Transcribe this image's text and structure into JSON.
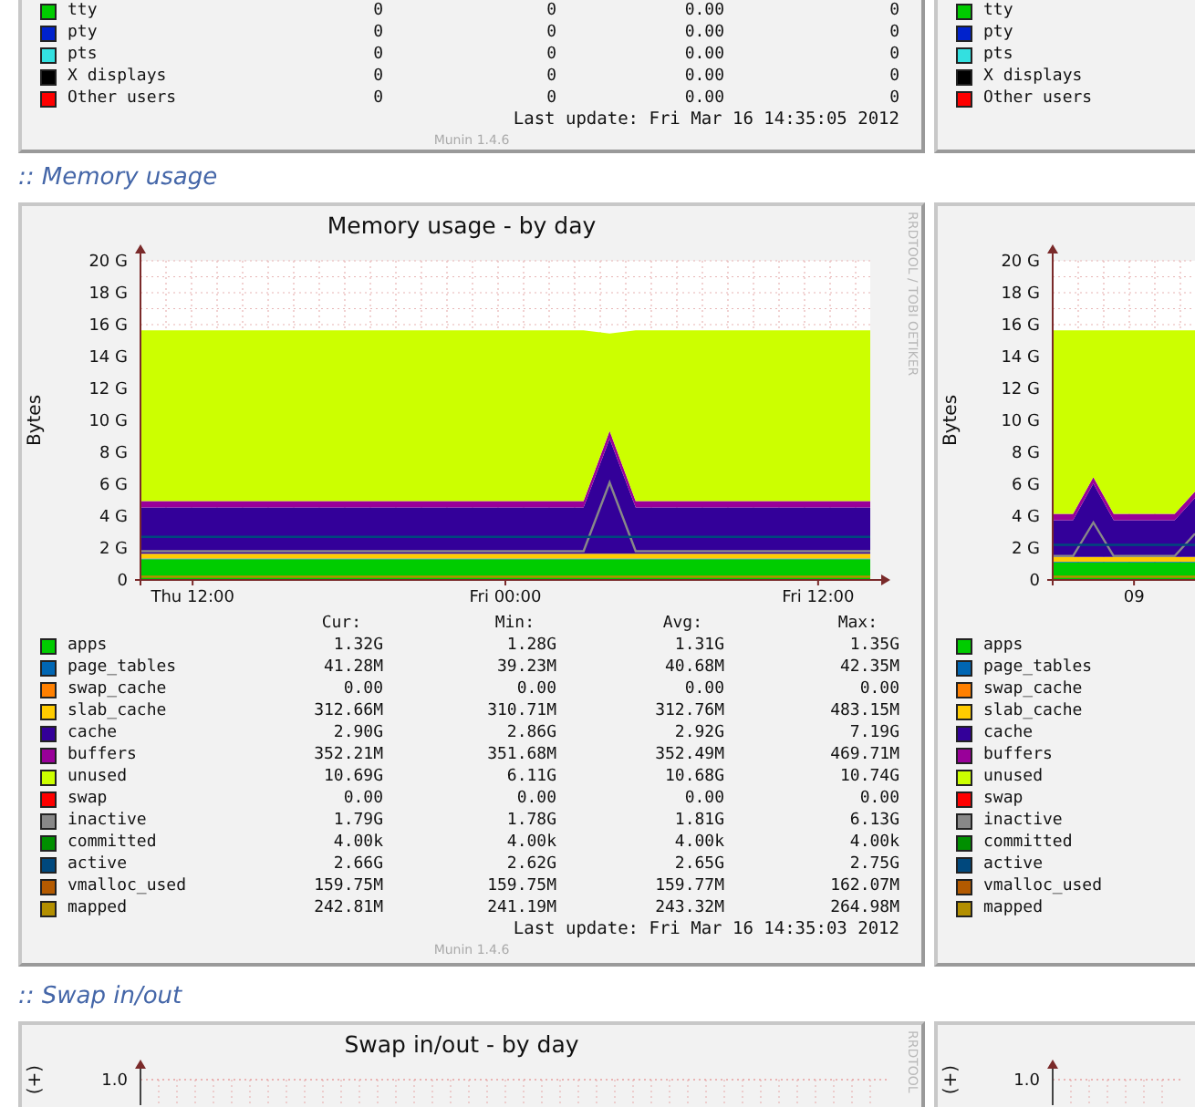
{
  "sections": [
    {
      "panels": [
        {
          "legend": [
            {
              "name": "tty",
              "color": "#00cc00",
              "cur": "0",
              "min": "0",
              "avg": "0.00",
              "max": "0"
            },
            {
              "name": "pty",
              "color": "#0022cc",
              "cur": "0",
              "min": "0",
              "avg": "0.00",
              "max": "0"
            },
            {
              "name": "pts",
              "color": "#33e0e0",
              "cur": "0",
              "min": "0",
              "avg": "0.00",
              "max": "0"
            },
            {
              "name": "X displays",
              "color": "#000000",
              "cur": "0",
              "min": "0",
              "avg": "0.00",
              "max": "0"
            },
            {
              "name": "Other users",
              "color": "#ff0000",
              "cur": "0",
              "min": "0",
              "avg": "0.00",
              "max": "0"
            }
          ],
          "last_update": "Last update: Fri Mar 16 14:35:05 2012",
          "version": "Munin 1.4.6"
        },
        {
          "legend": [
            {
              "name": "tty",
              "color": "#00cc00"
            },
            {
              "name": "pty",
              "color": "#0022cc"
            },
            {
              "name": "pts",
              "color": "#33e0e0"
            },
            {
              "name": "X displays",
              "color": "#000000"
            },
            {
              "name": "Other users",
              "color": "#ff0000"
            }
          ]
        }
      ]
    },
    {
      "heading": ":: Memory usage",
      "panels": [
        {
          "vendor_text": "RRDTOOL / TOBI OETIKER",
          "chart_data": {
            "type": "area",
            "stacked": true,
            "grid": true,
            "title": "Memory usage - by day",
            "ylabel": "Bytes",
            "ylim": [
              0,
              20
            ],
            "categories": [
              null,
              null,
              "Thu 12:00",
              null,
              null,
              null,
              null,
              null,
              null,
              null,
              null,
              null,
              null,
              null,
              "Fri 00:00",
              null,
              null,
              null,
              null,
              null,
              null,
              null,
              null,
              null,
              null,
              null,
              "Fri 12:00",
              null,
              null
            ],
            "yticks": [
              {
                "value": 0,
                "label": "0"
              },
              {
                "value": 2,
                "label": "2 G"
              },
              {
                "value": 4,
                "label": "4 G"
              },
              {
                "value": 6,
                "label": "6 G"
              },
              {
                "value": 8,
                "label": "8 G"
              },
              {
                "value": 10,
                "label": "10 G"
              },
              {
                "value": 12,
                "label": "12 G"
              },
              {
                "value": 14,
                "label": "14 G"
              },
              {
                "value": 16,
                "label": "16 G"
              },
              {
                "value": 18,
                "label": "18 G"
              },
              {
                "value": 20,
                "label": "20 G"
              }
            ],
            "series": [
              {
                "name": "apps",
                "type": "area",
                "color": "#00cc00",
                "values": [
                  1.3,
                  1.3,
                  1.3,
                  1.3,
                  1.3,
                  1.3,
                  1.3,
                  1.3,
                  1.3,
                  1.3,
                  1.3,
                  1.3,
                  1.3,
                  1.3,
                  1.3,
                  1.3,
                  1.3,
                  1.3,
                  1.3,
                  1.3,
                  1.3,
                  1.3,
                  1.3,
                  1.3,
                  1.3,
                  1.3,
                  1.3,
                  1.3,
                  1.3
                ]
              },
              {
                "name": "page_tables",
                "type": "area",
                "color": "#0066b3",
                "values": [
                  0.04,
                  0.04,
                  0.04,
                  0.04,
                  0.04,
                  0.04,
                  0.04,
                  0.04,
                  0.04,
                  0.04,
                  0.04,
                  0.04,
                  0.04,
                  0.04,
                  0.04,
                  0.04,
                  0.04,
                  0.04,
                  0.04,
                  0.04,
                  0.04,
                  0.04,
                  0.04,
                  0.04,
                  0.04,
                  0.04,
                  0.04,
                  0.04,
                  0.04
                ]
              },
              {
                "name": "swap_cache",
                "type": "area",
                "color": "#ff8000",
                "values": [
                  null,
                  null,
                  null,
                  null,
                  null,
                  null,
                  null,
                  null,
                  null,
                  null,
                  null,
                  null,
                  null,
                  null,
                  null,
                  null,
                  null,
                  null,
                  null,
                  null,
                  null,
                  null,
                  null,
                  null,
                  null,
                  null,
                  null,
                  null,
                  null
                ]
              },
              {
                "name": "slab_cache",
                "type": "area",
                "color": "#ffcc00",
                "values": [
                  0.3,
                  0.3,
                  0.3,
                  0.3,
                  0.3,
                  0.3,
                  0.3,
                  0.3,
                  0.3,
                  0.3,
                  0.3,
                  0.3,
                  0.3,
                  0.3,
                  0.3,
                  0.3,
                  0.3,
                  0.3,
                  0.3,
                  0.3,
                  0.3,
                  0.3,
                  0.3,
                  0.3,
                  0.3,
                  0.3,
                  0.3,
                  0.3,
                  0.3
                ]
              },
              {
                "name": "cache",
                "type": "area",
                "color": "#330099",
                "values": [
                  2.9,
                  2.9,
                  2.9,
                  2.9,
                  2.9,
                  2.9,
                  2.9,
                  2.9,
                  2.9,
                  2.9,
                  2.9,
                  2.9,
                  2.9,
                  2.9,
                  2.9,
                  2.9,
                  2.9,
                  2.9,
                  7.2,
                  2.9,
                  2.9,
                  2.9,
                  2.9,
                  2.9,
                  2.9,
                  2.9,
                  2.9,
                  2.9,
                  2.9
                ]
              },
              {
                "name": "buffers",
                "type": "area",
                "color": "#990099",
                "values": [
                  0.4,
                  0.4,
                  0.4,
                  0.4,
                  0.4,
                  0.4,
                  0.4,
                  0.4,
                  0.4,
                  0.4,
                  0.4,
                  0.4,
                  0.4,
                  0.4,
                  0.4,
                  0.4,
                  0.4,
                  0.4,
                  0.5,
                  0.4,
                  0.4,
                  0.4,
                  0.4,
                  0.4,
                  0.4,
                  0.4,
                  0.4,
                  0.4,
                  0.4
                ]
              },
              {
                "name": "unused",
                "type": "area",
                "color": "#ccff00",
                "values": [
                  10.7,
                  10.7,
                  10.7,
                  10.7,
                  10.7,
                  10.7,
                  10.7,
                  10.7,
                  10.7,
                  10.7,
                  10.7,
                  10.7,
                  10.7,
                  10.7,
                  10.7,
                  10.7,
                  10.7,
                  10.7,
                  6.1,
                  10.7,
                  10.7,
                  10.7,
                  10.7,
                  10.7,
                  10.7,
                  10.7,
                  10.7,
                  10.7,
                  10.7
                ]
              },
              {
                "name": "swap",
                "type": "area",
                "color": "#ff0000",
                "values": [
                  null,
                  null,
                  null,
                  null,
                  null,
                  null,
                  null,
                  null,
                  null,
                  null,
                  null,
                  null,
                  null,
                  null,
                  null,
                  null,
                  null,
                  null,
                  null,
                  null,
                  null,
                  null,
                  null,
                  null,
                  null,
                  null,
                  null,
                  null,
                  null
                ]
              },
              {
                "name": "inactive",
                "type": "line",
                "color": "#888888",
                "values": [
                  1.8,
                  1.8,
                  1.8,
                  1.8,
                  1.8,
                  1.8,
                  1.8,
                  1.8,
                  1.8,
                  1.8,
                  1.8,
                  1.8,
                  1.8,
                  1.8,
                  1.8,
                  1.8,
                  1.8,
                  1.8,
                  6.1,
                  1.8,
                  1.8,
                  1.8,
                  1.8,
                  1.8,
                  1.8,
                  1.8,
                  1.8,
                  1.8,
                  1.8
                ]
              },
              {
                "name": "committed",
                "type": "line",
                "color": "#008f00",
                "values": [
                  null,
                  null,
                  null,
                  null,
                  null,
                  null,
                  null,
                  null,
                  null,
                  null,
                  null,
                  null,
                  null,
                  null,
                  null,
                  null,
                  null,
                  null,
                  null,
                  null,
                  null,
                  null,
                  null,
                  null,
                  null,
                  null,
                  null,
                  null,
                  null
                ]
              },
              {
                "name": "active",
                "type": "line",
                "color": "#00487d",
                "values": [
                  2.7,
                  2.7,
                  2.7,
                  2.7,
                  2.7,
                  2.7,
                  2.7,
                  2.7,
                  2.7,
                  2.7,
                  2.7,
                  2.7,
                  2.7,
                  2.7,
                  2.7,
                  2.7,
                  2.7,
                  2.7,
                  2.7,
                  2.7,
                  2.7,
                  2.7,
                  2.7,
                  2.7,
                  2.7,
                  2.7,
                  2.7,
                  2.7,
                  2.7
                ]
              },
              {
                "name": "vmalloc_used",
                "type": "line",
                "color": "#b35a00",
                "values": [
                  null,
                  null,
                  null,
                  null,
                  null,
                  null,
                  null,
                  null,
                  null,
                  null,
                  null,
                  null,
                  null,
                  null,
                  null,
                  null,
                  null,
                  null,
                  null,
                  null,
                  null,
                  null,
                  null,
                  null,
                  null,
                  null,
                  null,
                  null,
                  null
                ]
              },
              {
                "name": "mapped",
                "type": "line",
                "color": "#b38f00",
                "values": [
                  0.2,
                  0.2,
                  0.2,
                  0.2,
                  0.2,
                  0.2,
                  0.2,
                  0.2,
                  0.2,
                  0.2,
                  0.2,
                  0.2,
                  0.2,
                  0.2,
                  0.2,
                  0.2,
                  0.2,
                  0.2,
                  0.2,
                  0.2,
                  0.2,
                  0.2,
                  0.2,
                  0.2,
                  0.2,
                  0.2,
                  0.2,
                  0.2,
                  0.2
                ]
              }
            ]
          },
          "legend_headers": [
            "Cur:",
            "Min:",
            "Avg:",
            "Max:"
          ],
          "stats": [
            {
              "cur": "1.32G",
              "min": "1.28G",
              "avg": "1.31G",
              "max": "1.35G"
            },
            {
              "cur": "41.28M",
              "min": "39.23M",
              "avg": "40.68M",
              "max": "42.35M"
            },
            {
              "cur": "0.00",
              "min": "0.00",
              "avg": "0.00",
              "max": "0.00"
            },
            {
              "cur": "312.66M",
              "min": "310.71M",
              "avg": "312.76M",
              "max": "483.15M"
            },
            {
              "cur": "2.90G",
              "min": "2.86G",
              "avg": "2.92G",
              "max": "7.19G"
            },
            {
              "cur": "352.21M",
              "min": "351.68M",
              "avg": "352.49M",
              "max": "469.71M"
            },
            {
              "cur": "10.69G",
              "min": "6.11G",
              "avg": "10.68G",
              "max": "10.74G"
            },
            {
              "cur": "0.00",
              "min": "0.00",
              "avg": "0.00",
              "max": "0.00"
            },
            {
              "cur": "1.79G",
              "min": "1.78G",
              "avg": "1.81G",
              "max": "6.13G"
            },
            {
              "cur": "4.00k",
              "min": "4.00k",
              "avg": "4.00k",
              "max": "4.00k"
            },
            {
              "cur": "2.66G",
              "min": "2.62G",
              "avg": "2.65G",
              "max": "2.75G"
            },
            {
              "cur": "159.75M",
              "min": "159.75M",
              "avg": "159.77M",
              "max": "162.07M"
            },
            {
              "cur": "242.81M",
              "min": "241.19M",
              "avg": "243.32M",
              "max": "264.98M"
            }
          ],
          "last_update": "Last update: Fri Mar 16 14:35:03 2012",
          "version": "Munin 1.4.6"
        },
        {
          "chart_data": {
            "type": "area",
            "stacked": true,
            "grid": true,
            "ylabel": "Bytes",
            "ylim": [
              0,
              20
            ],
            "categories": [
              null,
              null,
              null,
              null,
              "09",
              null,
              null,
              null
            ],
            "yticks": [
              {
                "value": 0,
                "label": "0"
              },
              {
                "value": 2,
                "label": "2 G"
              },
              {
                "value": 4,
                "label": "4 G"
              },
              {
                "value": 6,
                "label": "6 G"
              },
              {
                "value": 8,
                "label": "8 G"
              },
              {
                "value": 10,
                "label": "10 G"
              },
              {
                "value": 12,
                "label": "12 G"
              },
              {
                "value": 14,
                "label": "14 G"
              },
              {
                "value": 16,
                "label": "16 G"
              },
              {
                "value": 18,
                "label": "18 G"
              },
              {
                "value": 20,
                "label": "20 G"
              }
            ],
            "series": [
              {
                "name": "apps",
                "type": "area",
                "color": "#00cc00",
                "values": [
                  1.1,
                  1.1,
                  1.1,
                  1.1,
                  1.1,
                  1.1,
                  1.1,
                  1.1
                ]
              },
              {
                "name": "page_tables",
                "type": "area",
                "color": "#0066b3",
                "values": [
                  0.04,
                  0.04,
                  0.04,
                  0.04,
                  0.04,
                  0.04,
                  0.04,
                  0.04
                ]
              },
              {
                "name": "swap_cache",
                "type": "area",
                "color": "#ff8000",
                "values": [
                  null,
                  null,
                  null,
                  null,
                  null,
                  null,
                  null,
                  null
                ]
              },
              {
                "name": "slab_cache",
                "type": "area",
                "color": "#ffcc00",
                "values": [
                  0.3,
                  0.3,
                  0.3,
                  0.3,
                  0.3,
                  0.3,
                  0.3,
                  0.3
                ]
              },
              {
                "name": "cache",
                "type": "area",
                "color": "#330099",
                "values": [
                  2.3,
                  2.3,
                  4.6,
                  2.3,
                  2.3,
                  2.3,
                  2.3,
                  3.7
                ]
              },
              {
                "name": "buffers",
                "type": "area",
                "color": "#990099",
                "values": [
                  0.4,
                  0.4,
                  0.4,
                  0.4,
                  0.4,
                  0.4,
                  0.4,
                  0.4
                ]
              },
              {
                "name": "unused",
                "type": "area",
                "color": "#ccff00",
                "values": [
                  11.5,
                  11.5,
                  9.2,
                  11.5,
                  11.5,
                  11.5,
                  11.5,
                  10.1
                ]
              },
              {
                "name": "swap",
                "type": "area",
                "color": "#ff0000",
                "values": [
                  null,
                  null,
                  null,
                  null,
                  null,
                  null,
                  null,
                  null
                ]
              },
              {
                "name": "inactive",
                "type": "line",
                "color": "#888888",
                "values": [
                  1.5,
                  1.5,
                  3.6,
                  1.5,
                  1.5,
                  1.5,
                  1.5,
                  2.9
                ]
              },
              {
                "name": "committed",
                "type": "line",
                "color": "#008f00",
                "values": [
                  null,
                  null,
                  null,
                  null,
                  null,
                  null,
                  null,
                  null
                ]
              },
              {
                "name": "active",
                "type": "line",
                "color": "#00487d",
                "values": [
                  2.2,
                  2.2,
                  2.2,
                  2.2,
                  2.2,
                  2.2,
                  2.2,
                  2.2
                ]
              },
              {
                "name": "vmalloc_used",
                "type": "line",
                "color": "#b35a00",
                "values": [
                  null,
                  null,
                  null,
                  null,
                  null,
                  null,
                  null,
                  null
                ]
              },
              {
                "name": "mapped",
                "type": "line",
                "color": "#b38f00",
                "values": [
                  0.2,
                  0.2,
                  0.2,
                  0.2,
                  0.2,
                  0.2,
                  0.2,
                  0.2
                ]
              }
            ]
          }
        }
      ]
    },
    {
      "heading": ":: Swap in/out",
      "panels": [
        {
          "title": "Swap in/out - by day",
          "vendor_text": "RRDTOOL",
          "axis_label": "(+)",
          "tick_label": "1.0"
        },
        {
          "axis_label": "(+)",
          "tick_label": "1.0"
        }
      ]
    }
  ]
}
